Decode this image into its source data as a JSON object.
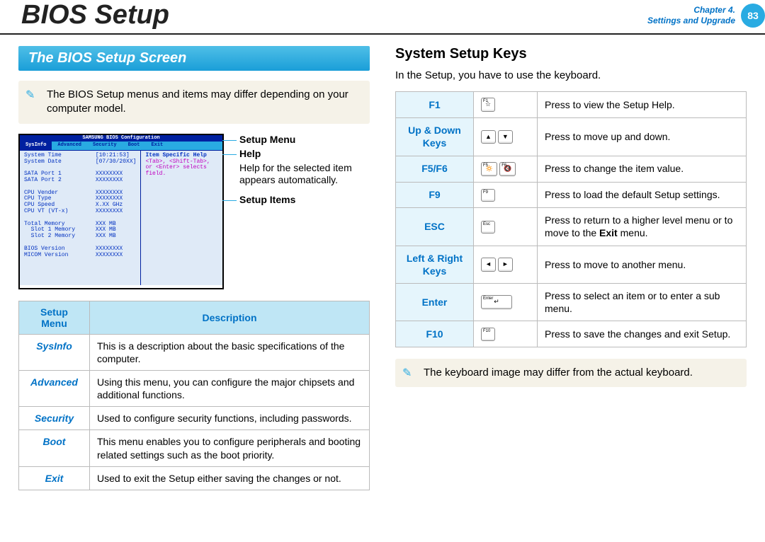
{
  "header": {
    "title": "BIOS Setup",
    "chapter_line1": "Chapter 4.",
    "chapter_line2": "Settings and Upgrade",
    "page_num": "83"
  },
  "left": {
    "section_title": "The BIOS Setup Screen",
    "note": "The BIOS Setup menus and items may differ depending on your computer model.",
    "bios": {
      "window_title": "SAMSUNG BIOS Configuration",
      "menu": [
        "SysInfo",
        "Advanced",
        "Security",
        "Boot",
        "Exit"
      ],
      "lines": "System Time          [10:21:53]\nSystem Date          [07/30/20XX]\n\nSATA Port 1          XXXXXXXX\nSATA Port 2          XXXXXXXX\n\nCPU Vender           XXXXXXXX\nCPU Type             XXXXXXXX\nCPU Speed            X.XX GHz\nCPU VT (VT-x)        XXXXXXXX\n\nTotal Memory         XXX MB\n  Slot 1 Memory      XXX MB\n  Slot 2 Memory      XXX MB\n\nBIOS Version         XXXXXXXX\nMICOM Version        XXXXXXXX",
      "help_title": "Item Specific Help",
      "help_body": "<Tab>, <Shift-Tab>, or <Enter> selects field."
    },
    "labels": {
      "setup_menu": "Setup Menu",
      "help": "Help",
      "help_desc": "Help for the selected item appears automatically.",
      "setup_items": "Setup Items"
    },
    "table_headers": {
      "menu": "Setup Menu",
      "desc": "Description"
    },
    "menu_rows": [
      {
        "name": "SysInfo",
        "desc": "This is a description about the basic specifications of the computer."
      },
      {
        "name": "Advanced",
        "desc": "Using this menu, you can configure the major chipsets and additional functions."
      },
      {
        "name": "Security",
        "desc": "Used to configure security functions, including passwords."
      },
      {
        "name": "Boot",
        "desc": "This menu enables you to configure peripherals and booting related settings such as the boot priority."
      },
      {
        "name": "Exit",
        "desc": "Used to exit the Setup either saving the changes or not."
      }
    ]
  },
  "right": {
    "title": "System Setup Keys",
    "intro": "In the Setup, you have to use the keyboard.",
    "rows": [
      {
        "name": "F1",
        "keys": [
          {
            "sup": "F1",
            "glyph": "☆"
          }
        ],
        "desc": "Press to view the Setup Help."
      },
      {
        "name": "Up & Down Keys",
        "keys": [
          {
            "glyph": "▲"
          },
          {
            "glyph": "▼"
          }
        ],
        "desc": "Press to move up and down."
      },
      {
        "name": "F5/F6",
        "keys": [
          {
            "sup": "F5",
            "glyph": "🔅"
          },
          {
            "sup": "F6",
            "glyph": "🔇"
          }
        ],
        "desc": "Press to change the item value."
      },
      {
        "name": "F9",
        "keys": [
          {
            "sup": "F9",
            "glyph": ""
          }
        ],
        "desc": "Press to load the default Setup settings."
      },
      {
        "name": "ESC",
        "keys": [
          {
            "sup": "Esc",
            "glyph": ""
          }
        ],
        "desc_html": "Press to return to a higher level menu or to move to the <b>Exit</b> menu."
      },
      {
        "name": "Left & Right Keys",
        "keys": [
          {
            "glyph": "◄"
          },
          {
            "glyph": "►"
          }
        ],
        "desc": "Press to move to another menu."
      },
      {
        "name": "Enter",
        "keys": [
          {
            "sup": "Enter",
            "glyph": "↵",
            "wide": true
          }
        ],
        "desc": "Press to select an item or to enter a sub menu."
      },
      {
        "name": "F10",
        "keys": [
          {
            "sup": "F10",
            "glyph": ""
          }
        ],
        "desc": "Press to save the changes and exit Setup."
      }
    ],
    "note": "The keyboard image may differ from the actual keyboard."
  }
}
